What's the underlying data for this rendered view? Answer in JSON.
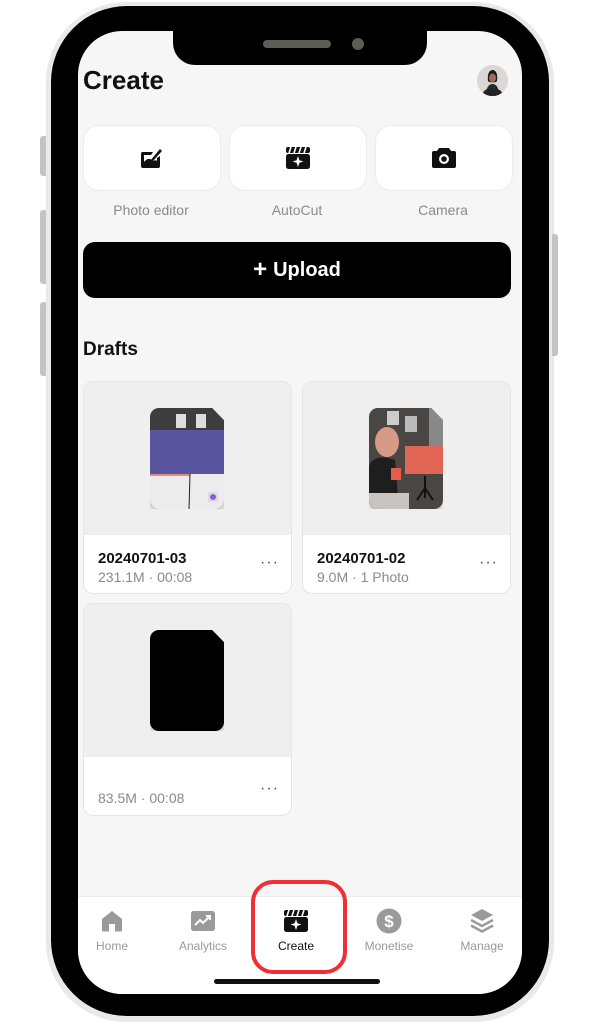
{
  "header": {
    "title": "Create",
    "avatar_icon": "user-avatar"
  },
  "tools": [
    {
      "label": "Photo editor",
      "icon": "photo-edit-icon"
    },
    {
      "label": "AutoCut",
      "icon": "clapperboard-sparkle-icon"
    },
    {
      "label": "Camera",
      "icon": "camera-icon"
    }
  ],
  "upload": {
    "plus": "+",
    "label": "Upload"
  },
  "drafts": {
    "title": "Drafts",
    "items": [
      {
        "name": "20240701-03",
        "meta": "231.1M · 00:08",
        "more": "···"
      },
      {
        "name": "20240701-02",
        "meta": "9.0M · 1 Photo",
        "more": "···"
      },
      {
        "name": "",
        "meta": "83.5M · 00:08",
        "more": "···"
      }
    ]
  },
  "tabbar": {
    "items": [
      {
        "label": "Home",
        "icon": "home-icon"
      },
      {
        "label": "Analytics",
        "icon": "analytics-icon"
      },
      {
        "label": "Create",
        "icon": "create-icon",
        "active": true
      },
      {
        "label": "Monetise",
        "icon": "dollar-icon"
      },
      {
        "label": "Manage",
        "icon": "layers-icon"
      }
    ]
  },
  "colors": {
    "highlight": "#ef2f33",
    "primary": "#000000",
    "inactive": "#9a9a9a"
  }
}
